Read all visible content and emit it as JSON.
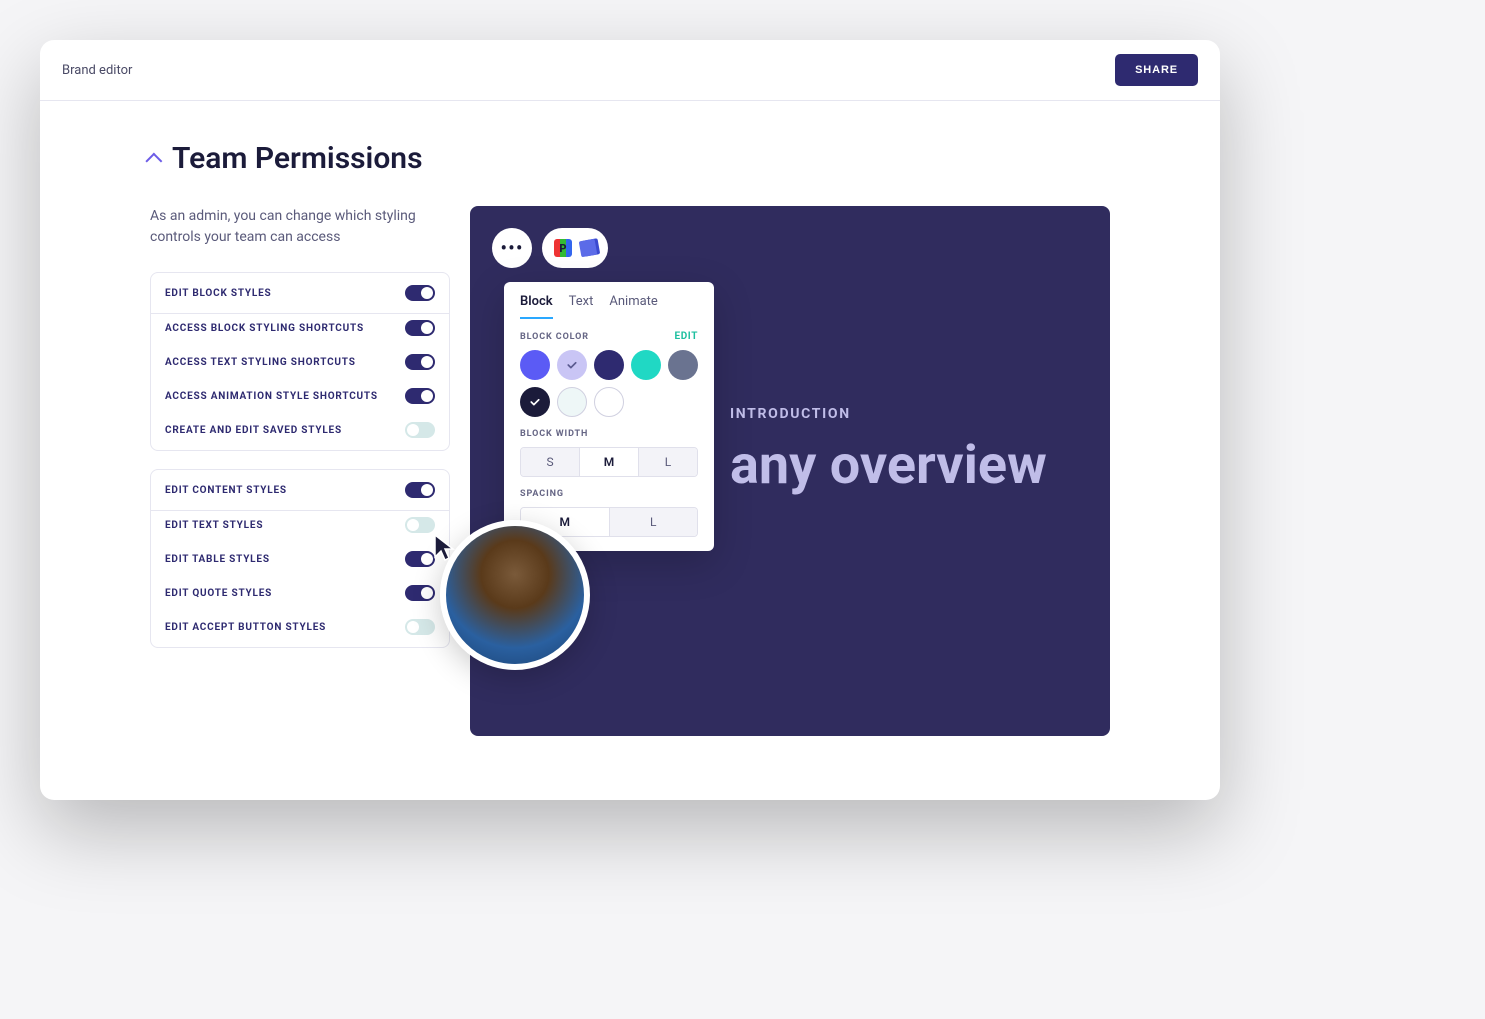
{
  "topbar": {
    "title": "Brand editor",
    "share_label": "SHARE"
  },
  "section": {
    "title": "Team Permissions",
    "description": "As an admin, you can change which styling controls your team can access"
  },
  "permissions": {
    "group1": {
      "header": {
        "label": "EDIT BLOCK STYLES",
        "on": true
      },
      "items": [
        {
          "label": "ACCESS BLOCK STYLING SHORTCUTS",
          "on": true
        },
        {
          "label": "ACCESS TEXT STYLING SHORTCUTS",
          "on": true
        },
        {
          "label": "ACCESS ANIMATION STYLE SHORTCUTS",
          "on": true
        },
        {
          "label": "CREATE AND EDIT SAVED STYLES",
          "on": false
        }
      ]
    },
    "group2": {
      "header": {
        "label": "EDIT CONTENT STYLES",
        "on": true
      },
      "items": [
        {
          "label": "EDIT TEXT STYLES",
          "on": false
        },
        {
          "label": "EDIT TABLE STYLES",
          "on": true
        },
        {
          "label": "EDIT QUOTE STYLES",
          "on": true
        },
        {
          "label": "EDIT ACCEPT BUTTON STYLES",
          "on": false
        }
      ]
    }
  },
  "style_panel": {
    "tabs": [
      "Block",
      "Text",
      "Animate"
    ],
    "active_tab": "Block",
    "block_color_label": "BLOCK COLOR",
    "edit_label": "EDIT",
    "swatches": [
      {
        "color": "#5b5bf5",
        "selected": false
      },
      {
        "color": "#c9c5f5",
        "selected": true,
        "check": "#5a5a90"
      },
      {
        "color": "#2e2a70",
        "selected": false
      },
      {
        "color": "#20d8c4",
        "selected": false
      },
      {
        "color": "#6a7390",
        "selected": false
      },
      {
        "color": "#1b1b3a",
        "selected": true,
        "check": "#ffffff"
      },
      {
        "color": "#ffffff",
        "selected": false,
        "outlined": true,
        "tint": "#eef7f7"
      },
      {
        "color": "#ffffff",
        "selected": false,
        "outlined": true
      }
    ],
    "width_label": "BLOCK WIDTH",
    "width_options": [
      "S",
      "M",
      "L"
    ],
    "width_selected": "M",
    "spacing_label": "SPACING",
    "spacing_options": [
      "M",
      "L"
    ],
    "spacing_selected": "M"
  },
  "slide": {
    "eyebrow": "INTRODUCTION",
    "title": "any overview"
  }
}
